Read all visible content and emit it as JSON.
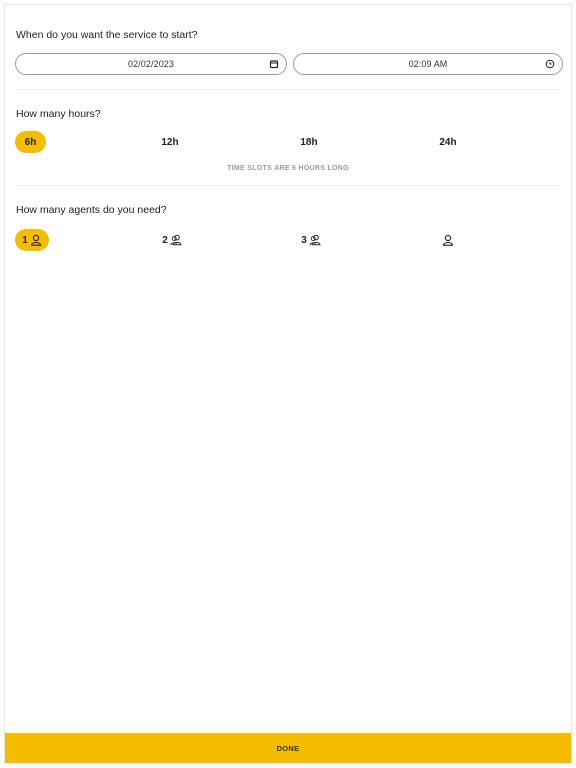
{
  "start": {
    "question": "When do you want the service to start?",
    "date_value": "02/02/2023",
    "time_value": "02:09 AM",
    "date_icon": "calendar-icon",
    "time_icon": "clock-icon"
  },
  "hours": {
    "question": "How many hours?",
    "options": [
      "6h",
      "12h",
      "18h",
      "24h"
    ],
    "selected": "6h",
    "note": "TIME SLOTS ARE 6 HOURS LONG"
  },
  "agents": {
    "question": "How many agents do you need?",
    "options": [
      {
        "label": "1",
        "icon": "person-icon"
      },
      {
        "label": "2",
        "icon": "people-icon"
      },
      {
        "label": "3",
        "icon": "people-icon"
      },
      {
        "label": "",
        "icon": "person-outline-icon"
      }
    ],
    "selected": "1"
  },
  "footer": {
    "done_label": "DONE"
  },
  "colors": {
    "accent": "#f5bd00",
    "border": "#9a9a9a",
    "note": "#9a9a9a"
  }
}
